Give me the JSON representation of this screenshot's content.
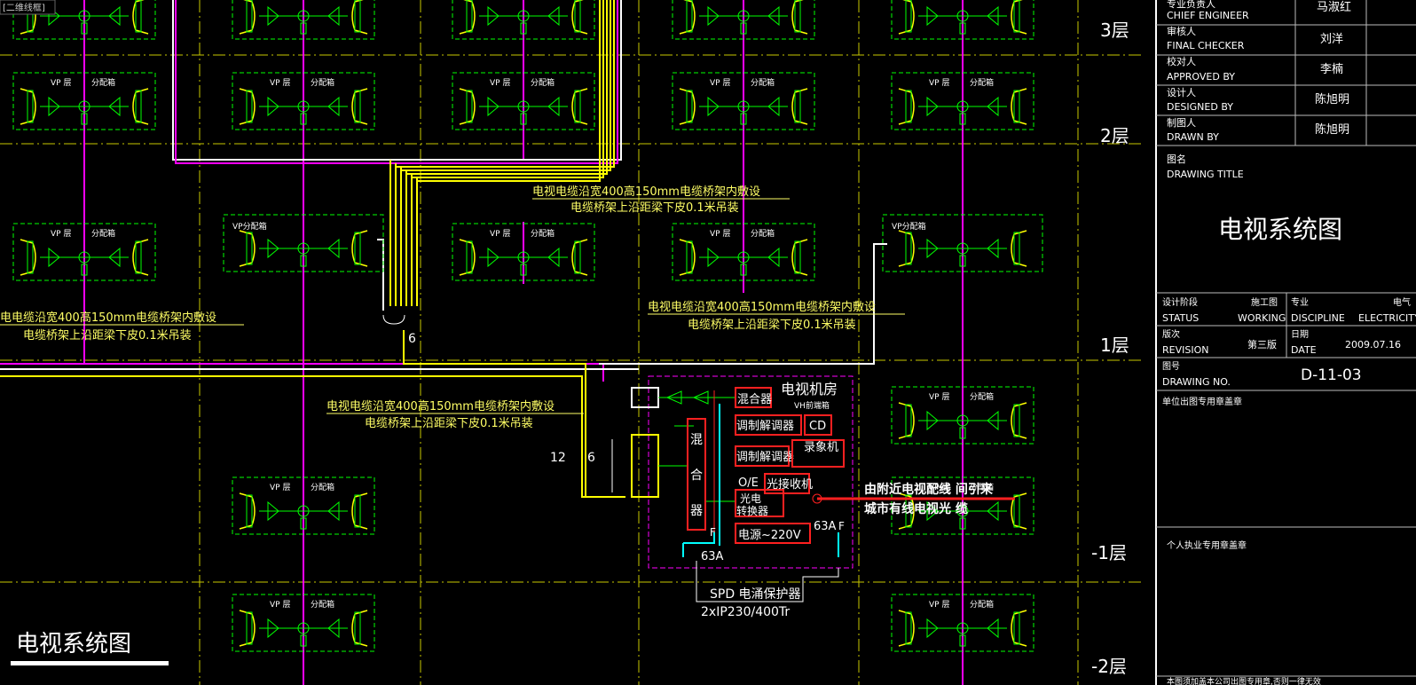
{
  "viewport_label": "[二维线框]",
  "colors": {
    "background": "#000000",
    "grid": "#ffff00",
    "magenta": "#ff00ff",
    "yellow": "#ffff00",
    "white": "#ffffff",
    "green": "#00ff00",
    "red": "#ff2020",
    "cyan": "#00ffff"
  },
  "floor_labels": [
    "3层",
    "2层",
    "1层",
    "-1层",
    "-2层"
  ],
  "box_labels": {
    "vp_floor_prefix": "VP 层",
    "vp_floor_suffix": "分配箱",
    "vp_box": "VP分配箱",
    "vh_box": "VH前端箱"
  },
  "annotations": {
    "cable_top_line1": "电视电缆沿宽400高150mm电缆桥架内敷设",
    "cable_top_line2": "电缆桥架上沿距梁下皮0.1米吊装",
    "cable_left_line1": "电电缆沿宽400高150mm电缆桥架内敷设",
    "cable_left_line2": "电缆桥架上沿距梁下皮0.1米吊装",
    "cable_mid_line1": "电视电缆沿宽400高150mm电缆桥架内敷设",
    "cable_mid_line2": "电缆桥架上沿距梁下皮0.1米吊装",
    "cable_low_line1": "电视电缆沿宽400高150mm电缆桥架内敷设",
    "cable_low_line2": "电缆桥架上沿距梁下皮0.1米吊装",
    "count_6a": "6",
    "count_12": "12",
    "count_6b": "6"
  },
  "equipment_room": {
    "title": "电视机房",
    "mixer": "混合器",
    "mixer_v1": "混",
    "mixer_v2": "合",
    "mixer_v3": "器",
    "demodulator": "调制解调器",
    "cd": "CD",
    "vcr": "录象机",
    "oe_label": "O/E",
    "optical_receiver": "光接收机",
    "converter_line1": "光电",
    "converter_line2": "转换器",
    "power": "电源~220V",
    "breaker_right": "63A",
    "breaker_left": "63A",
    "f_left": "F",
    "f_right": "F",
    "spd": "SPD 电涌保护器",
    "spd_model": "2xIP230/400Tr",
    "incoming_line1": "由附近电视配线 间引来",
    "incoming_line2": "城市有线电视光 缆"
  },
  "drawing_title_big": "电视系统图",
  "title_block": {
    "chief_cn": "专业负责人",
    "chief_en": "CHIEF ENGINEER",
    "chief_name": "马淑红",
    "checker_cn": "审核人",
    "checker_en": "FINAL CHECKER",
    "checker_name": "刘洋",
    "approved_cn": "校对人",
    "approved_en": "APPROVED BY",
    "approved_name": "李楠",
    "designed_cn": "设计人",
    "designed_en": "DESIGNED BY",
    "designed_name": "陈旭明",
    "drawn_cn": "制图人",
    "drawn_en": "DRAWN BY",
    "drawn_name": "陈旭明",
    "title_cn": "图名",
    "title_en": "DRAWING TITLE",
    "title_value": "电视系统图",
    "status_cn": "设计阶段",
    "status_en": "STATUS",
    "status_value_cn": "施工图",
    "status_value_en": "WORKING",
    "discipline_cn": "专业",
    "discipline_en": "DISCIPLINE",
    "discipline_value_cn": "电气",
    "discipline_value_en": "ELECTRICITY",
    "revision_cn": "版次",
    "revision_en": "REVISION",
    "revision_value": "第三版",
    "date_cn": "日期",
    "date_en": "DATE",
    "date_value": "2009.07.16",
    "drawing_no_cn": "图号",
    "drawing_no_en": "DRAWING NO.",
    "drawing_no_value": "D-11-03",
    "unit_stamp": "单位出图专用章盖章",
    "personal_stamp": "个人执业专用章盖章",
    "bottom_note": "本图须加盖本公司出图专用章,否则一律无效"
  }
}
